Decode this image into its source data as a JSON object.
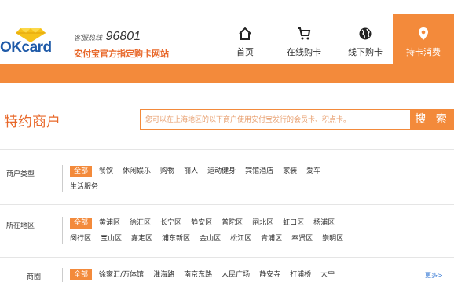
{
  "header": {
    "brand": "OKcard",
    "hotline_label": "客服热线",
    "hotline_number": "96801",
    "site_desc": "安付宝官方指定购卡网站"
  },
  "nav": [
    {
      "label": "首页",
      "icon": "home-icon"
    },
    {
      "label": "在线购卡",
      "icon": "cart-icon"
    },
    {
      "label": "线下购卡",
      "icon": "globe-icon"
    },
    {
      "label": "持卡消费",
      "icon": "location-pin-icon",
      "active": true
    }
  ],
  "search": {
    "title": "特约商户",
    "placeholder": "您可以在上海地区的以下商户使用安付宝发行的会员卡、积点卡。",
    "button": "搜 索"
  },
  "filters": {
    "type": {
      "label": "商户类型",
      "items": [
        "全部",
        "餐饮",
        "休闲娱乐",
        "购物",
        "丽人",
        "运动健身",
        "宾馆酒店",
        "家装",
        "爱车",
        "生活服务"
      ]
    },
    "area": {
      "label": "所在地区",
      "items": [
        "全部",
        "黄浦区",
        "徐汇区",
        "长宁区",
        "静安区",
        "普陀区",
        "闸北区",
        "虹口区",
        "杨浦区",
        "闵行区",
        "宝山区",
        "嘉定区",
        "浦东新区",
        "金山区",
        "松江区",
        "青浦区",
        "奉贤区",
        "崇明区"
      ]
    },
    "district": {
      "label": "商圈",
      "items": [
        "全部",
        "徐家汇/万体馆",
        "淮海路",
        "南京东路",
        "人民广场",
        "静安寺",
        "打浦桥",
        "大宁"
      ],
      "more": "更多>"
    }
  },
  "colors": {
    "accent": "#f38a3b",
    "title": "#e8682a",
    "link": "#3a7bd5"
  }
}
